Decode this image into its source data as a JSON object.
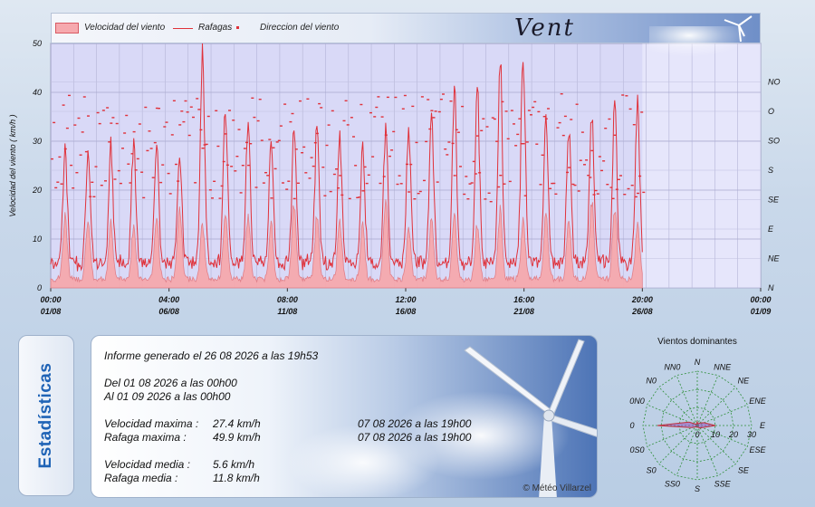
{
  "legend": {
    "speed_label": "Velocidad del viento",
    "gust_label": "Rafagas",
    "dir_label": "Direccion del viento",
    "title": "Vent"
  },
  "colors": {
    "area_fill": "#f6a9ae",
    "line": "#e0313a",
    "plot_bg": "#d9d9f7"
  },
  "chart_data": [
    {
      "type": "line",
      "ylabel": "Velocidad del viento ( km/h )",
      "ylim": [
        0,
        50
      ],
      "yticks": [
        0,
        10,
        20,
        30,
        40,
        50
      ],
      "x_start": "2026-08-01 00:00",
      "x_end": "2026-09-01 00:00",
      "x_unit": "hours",
      "x_ticks": [
        {
          "h": 0,
          "time": "00:00",
          "date": "01/08"
        },
        {
          "h": 124,
          "time": "04:00",
          "date": "06/08"
        },
        {
          "h": 248,
          "time": "08:00",
          "date": "11/08"
        },
        {
          "h": 372,
          "time": "12:00",
          "date": "16/08"
        },
        {
          "h": 496,
          "time": "16:00",
          "date": "21/08"
        },
        {
          "h": 620,
          "time": "20:00",
          "date": "26/08"
        },
        {
          "h": 744,
          "time": "00:00",
          "date": "01/09"
        }
      ],
      "right_axis_ticks": [
        "N",
        "NE",
        "E",
        "SE",
        "S",
        "SO",
        "O",
        "NO"
      ],
      "data_end_h": 620,
      "grid": true,
      "series": [
        {
          "name": "Velocidad del viento",
          "type": "area",
          "daily_peaks": [
            14,
            13,
            12,
            12,
            14,
            17,
            12,
            15,
            14,
            12,
            17,
            14,
            13,
            12,
            17,
            11,
            13,
            14,
            12,
            15,
            13,
            14,
            13,
            18,
            16,
            12,
            13,
            17
          ]
        },
        {
          "name": "Rafagas",
          "type": "line",
          "daily_peaks": [
            27,
            26,
            27,
            29,
            29,
            27,
            50,
            38,
            33,
            28,
            32,
            34,
            30,
            27,
            31,
            32,
            35,
            40,
            43,
            47,
            50,
            34,
            32,
            36,
            38,
            37,
            40,
            34
          ]
        },
        {
          "name": "Direccion del viento",
          "type": "scatter",
          "note_range": [
            "SE",
            "NO"
          ]
        }
      ]
    },
    {
      "type": "radar",
      "title": "Vientos dominantes",
      "directions": [
        "N",
        "NNE",
        "NE",
        "ENE",
        "E",
        "ESE",
        "SE",
        "SSE",
        "S",
        "SSO",
        "SO",
        "OSO",
        "O",
        "ONO",
        "NO",
        "NNO"
      ],
      "direction_labels": [
        "N",
        "NNE",
        "NE",
        "ENE",
        "E",
        "ESE",
        "SE",
        "SSE",
        "S",
        "SS0",
        "S0",
        "0S0",
        "0",
        "0N0",
        "N0",
        "NN0"
      ],
      "rticks": [
        0,
        10,
        20,
        30
      ],
      "values": [
        2,
        1,
        2,
        4,
        10,
        3,
        2,
        1,
        1,
        1,
        1,
        3,
        22,
        5,
        1,
        1
      ]
    }
  ],
  "stats": {
    "title": "Estadísticas",
    "generated": "Informe generado el 26 08 2026 a las 19h53",
    "from": "Del 01 08 2026 a las 00h00",
    "to": "Al 01 09 2026 a las 00h00",
    "max_speed_label": "Velocidad maxima :",
    "max_speed_value": "27.4 km/h",
    "max_speed_when": "07 08 2026 a las 19h00",
    "max_gust_label": "Rafaga maxima :",
    "max_gust_value": "49.9 km/h",
    "max_gust_when": "07 08 2026 a las 19h00",
    "avg_speed_label": "Velocidad media :",
    "avg_speed_value": "5.6 km/h",
    "avg_gust_label": "Rafaga media :",
    "avg_gust_value": "11.8 km/h",
    "copyright": "© Météo Villarzel"
  }
}
